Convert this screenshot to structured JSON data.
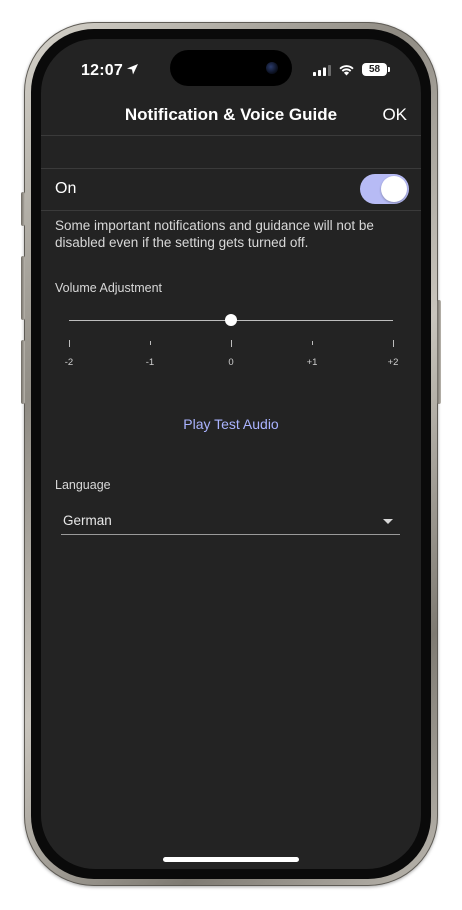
{
  "status_bar": {
    "time": "12:07",
    "battery_level": "58"
  },
  "header": {
    "title": "Notification & Voice Guide",
    "ok_label": "OK"
  },
  "voice_guide": {
    "label": "On",
    "enabled": true,
    "toggle_color": "#b7bbf5"
  },
  "note": "Some important notifications and guidance will not be disabled even if the setting gets turned off.",
  "volume": {
    "label": "Volume Adjustment",
    "ticks": [
      "-2",
      "-1",
      "0",
      "+1",
      "+2"
    ],
    "value": "0"
  },
  "play_test_label": "Play Test Audio",
  "language": {
    "label": "Language",
    "selected": "German"
  },
  "colors": {
    "accent": "#aab3ff",
    "background": "#232323"
  }
}
